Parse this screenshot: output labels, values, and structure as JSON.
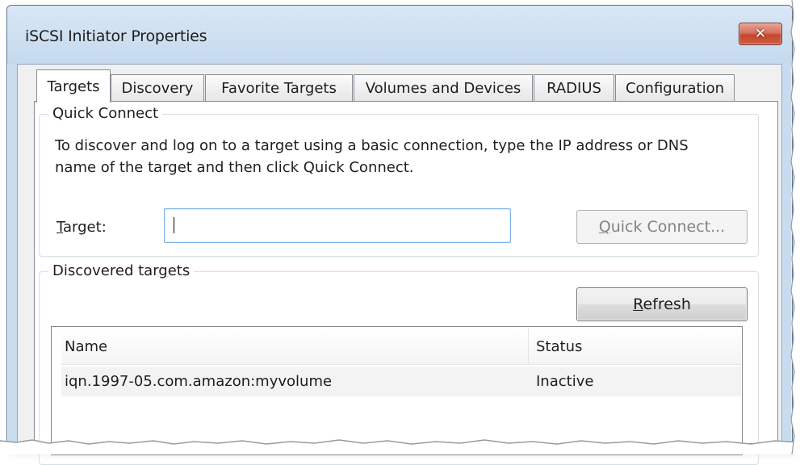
{
  "window": {
    "title": "iSCSI Initiator Properties",
    "close_glyph": "✕"
  },
  "tabs": [
    {
      "label": "Targets",
      "active": true
    },
    {
      "label": "Discovery",
      "active": false
    },
    {
      "label": "Favorite Targets",
      "active": false
    },
    {
      "label": "Volumes and Devices",
      "active": false
    },
    {
      "label": "RADIUS",
      "active": false
    },
    {
      "label": "Configuration",
      "active": false
    }
  ],
  "quick_connect": {
    "group_label": "Quick Connect",
    "description": "To discover and log on to a target using a basic connection, type the IP address or DNS name of the target and then click Quick Connect.",
    "target_label_pre": "",
    "target_label_mnemonic": "T",
    "target_label_post": "arget:",
    "target_value": "",
    "button_mnemonic": "Q",
    "button_rest": "uick Connect..."
  },
  "discovered": {
    "group_label_pre": "Discovered tar",
    "group_label_mnemonic": "g",
    "group_label_post": "ets",
    "refresh_mnemonic": "R",
    "refresh_rest": "efresh",
    "columns": [
      "Name",
      "Status"
    ],
    "rows": [
      {
        "name": "iqn.1997-05.com.amazon:myvolume",
        "status": "Inactive"
      }
    ]
  },
  "colors": {
    "title_bar": "#c9dcef",
    "close_button": "#c4462e",
    "input_focus_border": "#7eb4ea"
  }
}
